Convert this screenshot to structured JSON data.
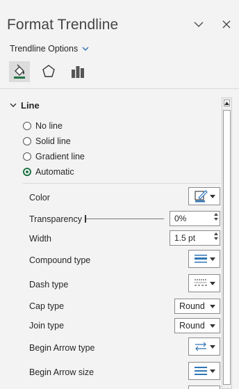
{
  "pane": {
    "title": "Format Trendline",
    "options_label": "Trendline Options"
  },
  "section": {
    "title": "Line",
    "line_types": [
      {
        "label": "No line",
        "selected": false
      },
      {
        "label": "Solid line",
        "selected": false
      },
      {
        "label": "Gradient line",
        "selected": false
      },
      {
        "label": "Automatic",
        "selected": true
      }
    ]
  },
  "props": {
    "color_label": "Color",
    "transparency_label": "Transparency",
    "transparency_value": "0%",
    "transparency_level": 0,
    "width_label": "Width",
    "width_value": "1.5 pt",
    "compound_label": "Compound type",
    "dash_label": "Dash type",
    "cap_label": "Cap type",
    "cap_value": "Round",
    "join_label": "Join type",
    "join_value": "Round",
    "begin_arrow_type_label": "Begin Arrow type",
    "begin_arrow_size_label": "Begin Arrow size"
  },
  "colors": {
    "accent": "#2e75b6",
    "radio_selected": "#1e7145"
  }
}
